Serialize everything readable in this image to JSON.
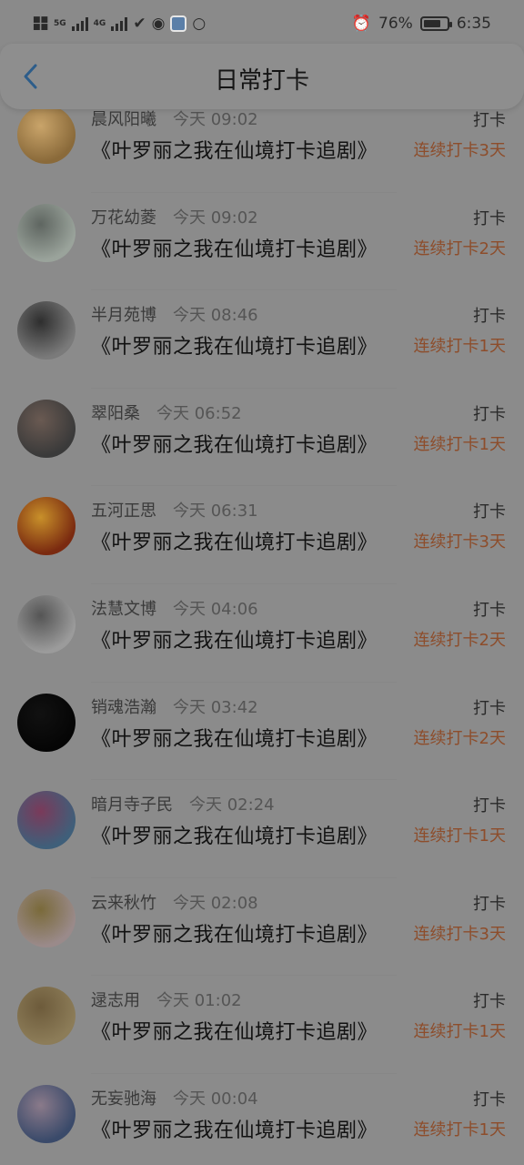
{
  "status_bar": {
    "battery_percent": "76%",
    "battery_level": 0.76,
    "time": "6:35",
    "network_5g": "5G",
    "network_4g": "4G"
  },
  "header": {
    "title": "日常打卡"
  },
  "list": [
    {
      "name": "晨风阳曦",
      "time": "今天 09:02",
      "book": "《叶罗丽之我在仙境打卡追剧》",
      "action": "打卡",
      "streak": "连续打卡3天",
      "avatar_colors": [
        "#8a6a3a",
        "#c9a46a"
      ]
    },
    {
      "name": "万花幼菱",
      "time": "今天 09:02",
      "book": "《叶罗丽之我在仙境打卡追剧》",
      "action": "打卡",
      "streak": "连续打卡2天",
      "avatar_colors": [
        "#9aa39b",
        "#5f6661"
      ]
    },
    {
      "name": "半月苑博",
      "time": "今天 08:46",
      "book": "《叶罗丽之我在仙境打卡追剧》",
      "action": "打卡",
      "streak": "连续打卡1天",
      "avatar_colors": [
        "#7a7a7a",
        "#2e2e2e"
      ]
    },
    {
      "name": "翠阳桑",
      "time": "今天 06:52",
      "book": "《叶罗丽之我在仙境打卡追剧》",
      "action": "打卡",
      "streak": "连续打卡1天",
      "avatar_colors": [
        "#3a3a3a",
        "#6a5a52"
      ]
    },
    {
      "name": "五河正思",
      "time": "今天 06:31",
      "book": "《叶罗丽之我在仙境打卡追剧》",
      "action": "打卡",
      "streak": "连续打卡3天",
      "avatar_colors": [
        "#7a2a10",
        "#c8902a"
      ]
    },
    {
      "name": "法慧文博",
      "time": "今天 04:06",
      "book": "《叶罗丽之我在仙境打卡追剧》",
      "action": "打卡",
      "streak": "连续打卡2天",
      "avatar_colors": [
        "#9b9b9b",
        "#555"
      ]
    },
    {
      "name": "销魂浩瀚",
      "time": "今天 03:42",
      "book": "《叶罗丽之我在仙境打卡追剧》",
      "action": "打卡",
      "streak": "连续打卡2天",
      "avatar_colors": [
        "#050505",
        "#111"
      ]
    },
    {
      "name": "暗月寺子民",
      "time": "今天 02:24",
      "book": "《叶罗丽之我在仙境打卡追剧》",
      "action": "打卡",
      "streak": "连续打卡1天",
      "avatar_colors": [
        "#3f5f7a",
        "#7a3a5a"
      ]
    },
    {
      "name": "云来秋竹",
      "time": "今天 02:08",
      "book": "《叶罗丽之我在仙境打卡追剧》",
      "action": "打卡",
      "streak": "连续打卡3天",
      "avatar_colors": [
        "#9a8a8a",
        "#7a6a3a"
      ]
    },
    {
      "name": "逯志用",
      "time": "今天 01:02",
      "book": "《叶罗丽之我在仙境打卡追剧》",
      "action": "打卡",
      "streak": "连续打卡1天",
      "avatar_colors": [
        "#8c7c58",
        "#6d5b3b"
      ]
    },
    {
      "name": "无妄驰海",
      "time": "今天 00:04",
      "book": "《叶罗丽之我在仙境打卡追剧》",
      "action": "打卡",
      "streak": "连续打卡1天",
      "avatar_colors": [
        "#3a4a6a",
        "#8a7a8a"
      ]
    }
  ]
}
